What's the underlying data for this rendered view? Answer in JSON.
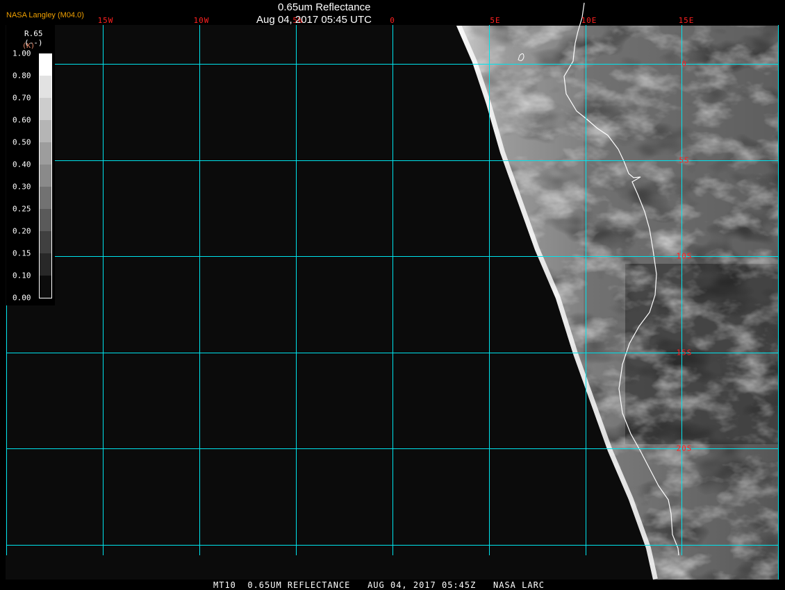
{
  "header": {
    "title": "0.65um Reflectance",
    "datetime": "Aug 04, 2017 05:45 UTC",
    "brand": "NASA Langley (M04.0)"
  },
  "map": {
    "lon_labels": [
      "15W",
      "10W",
      "5W",
      "0",
      "5E",
      "10E",
      "15E"
    ],
    "lat_labels": [
      "0",
      "5S",
      "10S",
      "15S",
      "20S"
    ],
    "grid_color": "#00e5ee",
    "label_color": "#ff2020",
    "coastline_color": "#ffffff"
  },
  "legend": {
    "variable": "R.65",
    "units": "(--)",
    "units_overlay": "(K)",
    "ticks": [
      "1.00",
      "0.80",
      "0.70",
      "0.60",
      "0.50",
      "0.40",
      "0.30",
      "0.25",
      "0.20",
      "0.15",
      "0.10",
      "0.00"
    ],
    "colors": [
      "#ffffff",
      "#e2e2e2",
      "#cdcdcd",
      "#b5b5b5",
      "#9d9d9d",
      "#8a8a8a",
      "#727272",
      "#5a5a5a",
      "#404040",
      "#282828",
      "#0c0c0c"
    ]
  },
  "footer": {
    "text": "MT10  0.65UM REFLECTANCE   AUG 04, 2017 05:45Z   NASA LARC"
  }
}
